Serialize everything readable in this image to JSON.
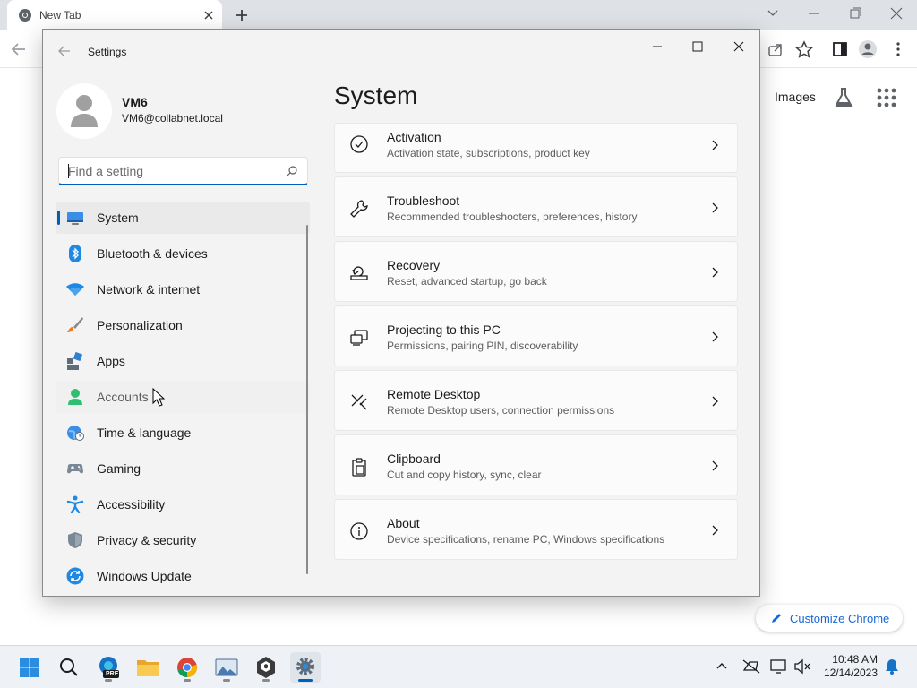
{
  "browser": {
    "tab_title": "New Tab",
    "ntp_images_link": "Images",
    "customize_label": "Customize Chrome"
  },
  "settings": {
    "window_title": "Settings",
    "user": {
      "name": "VM6",
      "email": "VM6@collabnet.local"
    },
    "search_placeholder": "Find a setting",
    "nav": [
      {
        "label": "System",
        "icon": "system-monitor-icon",
        "selected": true
      },
      {
        "label": "Bluetooth & devices",
        "icon": "bluetooth-icon"
      },
      {
        "label": "Network & internet",
        "icon": "wifi-icon"
      },
      {
        "label": "Personalization",
        "icon": "brush-icon"
      },
      {
        "label": "Apps",
        "icon": "apps-icon"
      },
      {
        "label": "Accounts",
        "icon": "accounts-icon",
        "hovered": true
      },
      {
        "label": "Time & language",
        "icon": "globe-clock-icon"
      },
      {
        "label": "Gaming",
        "icon": "gamepad-icon"
      },
      {
        "label": "Accessibility",
        "icon": "accessibility-icon"
      },
      {
        "label": "Privacy & security",
        "icon": "shield-icon"
      },
      {
        "label": "Windows Update",
        "icon": "update-icon"
      }
    ],
    "page_title": "System",
    "cards": [
      {
        "title": "Activation",
        "desc": "Activation state, subscriptions, product key",
        "icon": "activation-check-icon"
      },
      {
        "title": "Troubleshoot",
        "desc": "Recommended troubleshooters, preferences, history",
        "icon": "wrench-icon"
      },
      {
        "title": "Recovery",
        "desc": "Reset, advanced startup, go back",
        "icon": "recovery-icon"
      },
      {
        "title": "Projecting to this PC",
        "desc": "Permissions, pairing PIN, discoverability",
        "icon": "projecting-icon"
      },
      {
        "title": "Remote Desktop",
        "desc": "Remote Desktop users, connection permissions",
        "icon": "remote-desktop-icon"
      },
      {
        "title": "Clipboard",
        "desc": "Cut and copy history, sync, clear",
        "icon": "clipboard-icon"
      },
      {
        "title": "About",
        "desc": "Device specifications, rename PC, Windows specifications",
        "icon": "info-icon"
      }
    ]
  },
  "taskbar": {
    "time": "10:48 AM",
    "date": "12/14/2023",
    "pre_badge": "PRE",
    "apps": [
      "windows-start-icon",
      "search-icon",
      "edge-preview-icon",
      "file-explorer-icon",
      "chrome-icon",
      "photos-icon",
      "network-tool-icon",
      "settings-gear-icon"
    ]
  },
  "colors": {
    "accent": "#005fb8",
    "chrome_link": "#1967d2"
  }
}
